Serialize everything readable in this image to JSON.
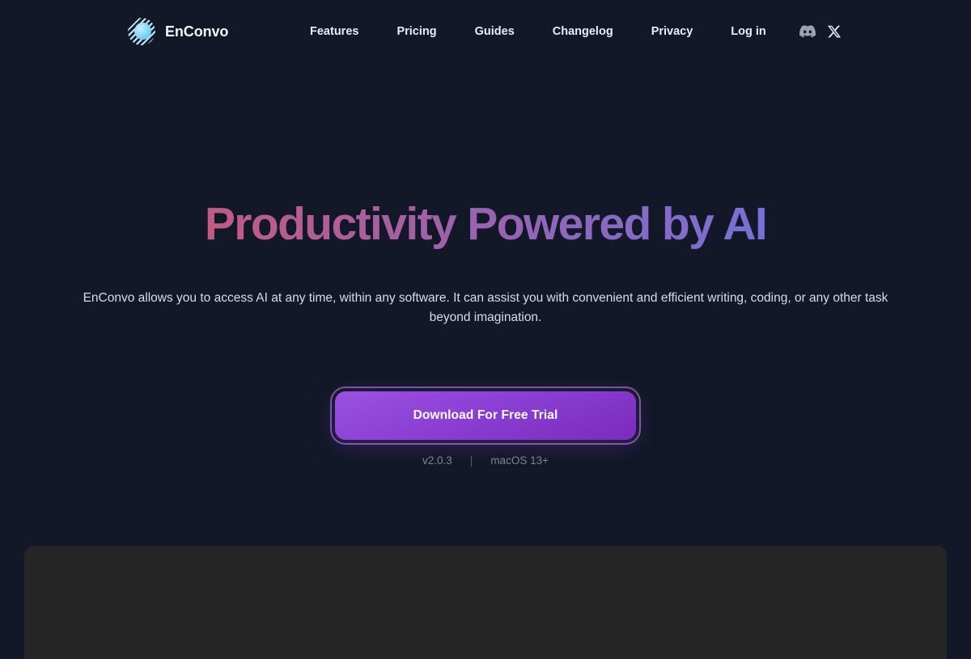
{
  "header": {
    "brand": {
      "name": "EnConvo",
      "logo_icon": "enconvo-sphere-logo-icon"
    },
    "nav": [
      {
        "label": "Features"
      },
      {
        "label": "Pricing"
      },
      {
        "label": "Guides"
      },
      {
        "label": "Changelog"
      },
      {
        "label": "Privacy"
      },
      {
        "label": "Log in"
      }
    ],
    "social": [
      {
        "icon": "discord-icon",
        "name": "Discord"
      },
      {
        "icon": "x-twitter-icon",
        "name": "X"
      }
    ]
  },
  "hero": {
    "headline": "Productivity Powered by AI",
    "subtitle": "EnConvo allows you to access AI at any time, within any software. It can assist you with convenient and efficient writing, coding, or any other task beyond imagination.",
    "cta_label": "Download For Free Trial",
    "version": "v2.0.3",
    "separator": "|",
    "platform": "macOS 13+"
  },
  "showcase": {
    "ghost_line_1": "",
    "ghost_line_2": ""
  },
  "colors": {
    "background": "#121827",
    "headline_gradient_start": "#d9566a",
    "headline_gradient_end": "#6f7fe0",
    "cta_gradient_start": "#9b51e0",
    "cta_gradient_end": "#7b2bbd",
    "brand_accent": "#7fd4f5",
    "panel": "#252525"
  }
}
